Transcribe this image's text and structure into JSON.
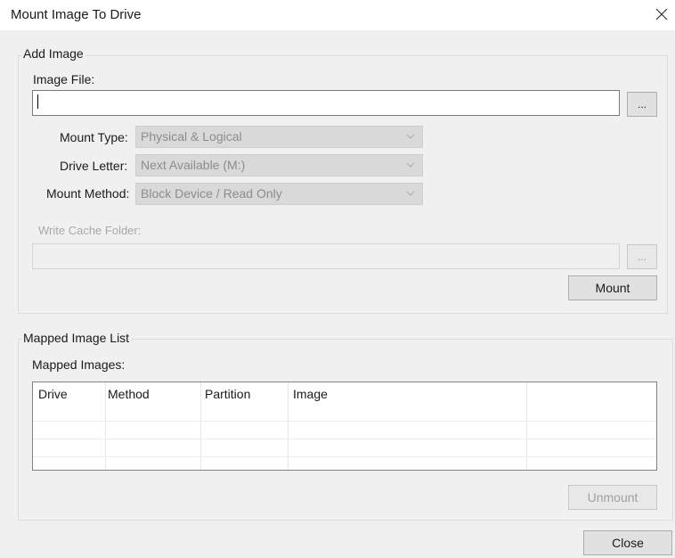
{
  "window": {
    "title": "Mount Image To Drive"
  },
  "add_image": {
    "group_label": "Add Image",
    "image_file_label": "Image File:",
    "image_file_value": "",
    "browse_label": "...",
    "mount_type_label": "Mount Type:",
    "mount_type_value": "Physical & Logical",
    "drive_letter_label": "Drive Letter:",
    "drive_letter_value": "Next Available (M:)",
    "mount_method_label": "Mount Method:",
    "mount_method_value": "Block Device / Read Only",
    "write_cache_label": "Write Cache Folder:",
    "write_cache_value": "",
    "write_cache_browse_label": "...",
    "mount_button": "Mount"
  },
  "mapped_list": {
    "group_label": "Mapped Image List",
    "list_label": "Mapped Images:",
    "columns": [
      "Drive",
      "Method",
      "Partition",
      "Image"
    ],
    "rows": [],
    "unmount_button": "Unmount"
  },
  "footer": {
    "close_button": "Close"
  },
  "colors": {
    "window_bg": "#f0f0f0",
    "titlebar_bg": "#ffffff",
    "disabled_text": "#a8a8a8",
    "combo_bg": "#d9d9d9"
  },
  "icons": {
    "close": "close-icon",
    "dropdown": "chevron-down-icon"
  }
}
